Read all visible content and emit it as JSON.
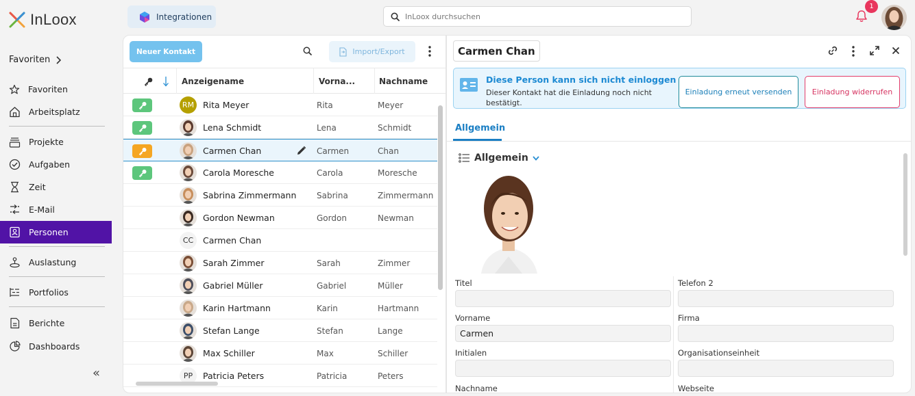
{
  "app": {
    "name": "InLoox"
  },
  "topbar": {
    "integrations_label": "Integrationen",
    "search_placeholder": "InLoox durchsuchen",
    "notification_count": "1"
  },
  "sidebar": {
    "favorites_header": "Favoriten",
    "items": [
      {
        "label": "Favoriten",
        "icon": "star-icon"
      },
      {
        "label": "Arbeitsplatz",
        "icon": "home-icon"
      },
      {
        "label": "Projekte",
        "icon": "projects-icon"
      },
      {
        "label": "Aufgaben",
        "icon": "check-circle-icon"
      },
      {
        "label": "Zeit",
        "icon": "hourglass-icon"
      },
      {
        "label": "E-Mail",
        "icon": "mail-sync-icon"
      },
      {
        "label": "Personen",
        "icon": "contacts-icon",
        "active": true
      },
      {
        "label": "Auslastung",
        "icon": "workload-icon"
      },
      {
        "label": "Portfolios",
        "icon": "portfolio-icon"
      },
      {
        "label": "Berichte",
        "icon": "report-icon"
      },
      {
        "label": "Dashboards",
        "icon": "dashboard-icon"
      }
    ],
    "collapse_label": "«"
  },
  "list": {
    "new_contact_label": "Neuer Kontakt",
    "import_export_label": "Import/Export",
    "columns": {
      "display_name": "Anzeigename",
      "first_name": "Vorna...",
      "last_name": "Nachname"
    },
    "rows": [
      {
        "display": "Rita Meyer",
        "first": "Rita",
        "last": "Meyer",
        "key": "green",
        "avatar": "RM",
        "avatar_color": "#b5a000"
      },
      {
        "display": "Lena Schmidt",
        "first": "Lena",
        "last": "Schmidt",
        "key": "green",
        "avatar": "photo",
        "avatar_color": "#5a3a2e"
      },
      {
        "display": "Carmen Chan",
        "first": "Carmen",
        "last": "Chan",
        "key": "orange",
        "avatar": "photo",
        "avatar_color": "#c9a27f",
        "selected": true
      },
      {
        "display": "Carola Moresche",
        "first": "Carola",
        "last": "Moresche",
        "key": "green",
        "avatar": "photo",
        "avatar_color": "#6b4a3a"
      },
      {
        "display": "Sabrina Zimmermann",
        "first": "Sabrina",
        "last": "Zimmermann",
        "key": "",
        "avatar": "photo",
        "avatar_color": "#c78e5c"
      },
      {
        "display": "Gordon Newman",
        "first": "Gordon",
        "last": "Newman",
        "key": "",
        "avatar": "photo",
        "avatar_color": "#3b2a22"
      },
      {
        "display": "Carmen Chan",
        "first": "",
        "last": "",
        "key": "",
        "avatar": "CC",
        "avatar_color": ""
      },
      {
        "display": "Sarah Zimmer",
        "first": "Sarah",
        "last": "Zimmer",
        "key": "",
        "avatar": "photo",
        "avatar_color": "#7a4e36"
      },
      {
        "display": "Gabriel Müller",
        "first": "Gabriel",
        "last": "Müller",
        "key": "",
        "avatar": "photo",
        "avatar_color": "#4e4e5a"
      },
      {
        "display": "Karin Hartmann",
        "first": "Karin",
        "last": "Hartmann",
        "key": "",
        "avatar": "photo",
        "avatar_color": "#c9a98a"
      },
      {
        "display": "Stefan Lange",
        "first": "Stefan",
        "last": "Lange",
        "key": "",
        "avatar": "photo",
        "avatar_color": "#3d4f6a"
      },
      {
        "display": "Max Schiller",
        "first": "Max",
        "last": "Schiller",
        "key": "",
        "avatar": "photo",
        "avatar_color": "#5c4536"
      },
      {
        "display": "Patricia Peters",
        "first": "Patricia",
        "last": "Peters",
        "key": "",
        "avatar": "PP",
        "avatar_color": ""
      }
    ]
  },
  "detail": {
    "title": "Carmen Chan",
    "notice_title": "Diese Person kann sich nicht einloggen",
    "notice_text": "Dieser Kontakt hat die Einladung noch nicht bestätigt.",
    "resend_label": "Einladung erneut versenden",
    "revoke_label": "Einladung widerrufen",
    "tab_label": "Allgemein",
    "section_label": "Allgemein",
    "fields": {
      "titel": {
        "label": "Titel",
        "value": ""
      },
      "vorname": {
        "label": "Vorname",
        "value": "Carmen"
      },
      "initialen": {
        "label": "Initialen",
        "value": ""
      },
      "nachname": {
        "label": "Nachname"
      },
      "telefon2": {
        "label": "Telefon 2",
        "value": ""
      },
      "firma": {
        "label": "Firma",
        "value": ""
      },
      "org": {
        "label": "Organisationseinheit",
        "value": ""
      },
      "webseite": {
        "label": "Webseite"
      }
    }
  },
  "colors": {
    "accent": "#5113a6",
    "primary_blue": "#1b7fc4",
    "key_green": "#5dc67c",
    "key_orange": "#f5a623",
    "danger": "#e33c6a"
  }
}
